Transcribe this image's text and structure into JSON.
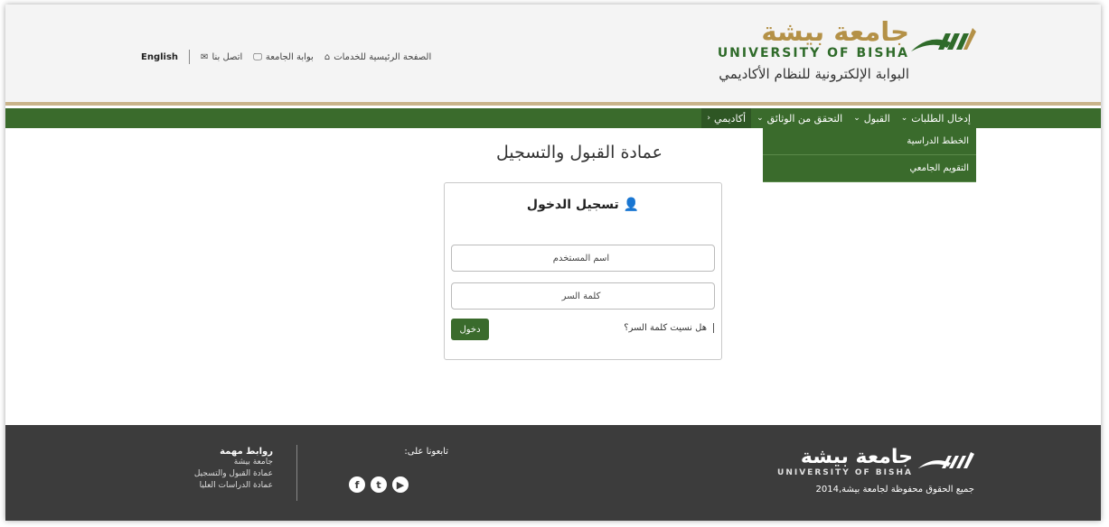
{
  "header": {
    "brand_ar": "جامعة بيشة",
    "brand_en": "UNIVERSITY OF BISHA",
    "portal_title": "البوابة الإلكترونية للنظام الأكاديمي",
    "links": {
      "home": "الصفحة الرئيسية للخدمات",
      "portal": "بوابة الجامعة",
      "contact": "اتصل بنا",
      "english": "English"
    }
  },
  "nav": {
    "items": [
      {
        "label": "أكاديمي",
        "chevron": "‹"
      },
      {
        "label": "التحقق من الوثائق",
        "chevron": "⌄"
      },
      {
        "label": "القبول",
        "chevron": "⌄"
      },
      {
        "label": "إدخال الطلبات",
        "chevron": "⌄"
      }
    ],
    "dropdown": [
      "الخطط الدراسية",
      "التقويم الجامعي"
    ]
  },
  "main": {
    "title": "عمادة القبول والتسجيل",
    "login": {
      "title": "تسجيل الدخول",
      "username_placeholder": "اسم المستخدم",
      "password_placeholder": "كلمة السر",
      "forgot": "هل نسيت كلمة السر؟",
      "submit": "دخول"
    }
  },
  "footer": {
    "brand_ar": "جامعة بيشة",
    "brand_en": "UNIVERSITY OF BISHA",
    "copyright": "جميع الحقوق محفوظة لجامعة بيشة,2014",
    "follow_title": "تابعونا على:",
    "links_title": "روابط مهمة",
    "links": [
      "جامعة بيشة",
      "عمادة القبول والتسجيل",
      "عمادة الدراسات العليا"
    ]
  },
  "colors": {
    "brand_green": "#3a6b2c",
    "brand_gold": "#b49147",
    "footer_bg": "#3c3c3c"
  }
}
